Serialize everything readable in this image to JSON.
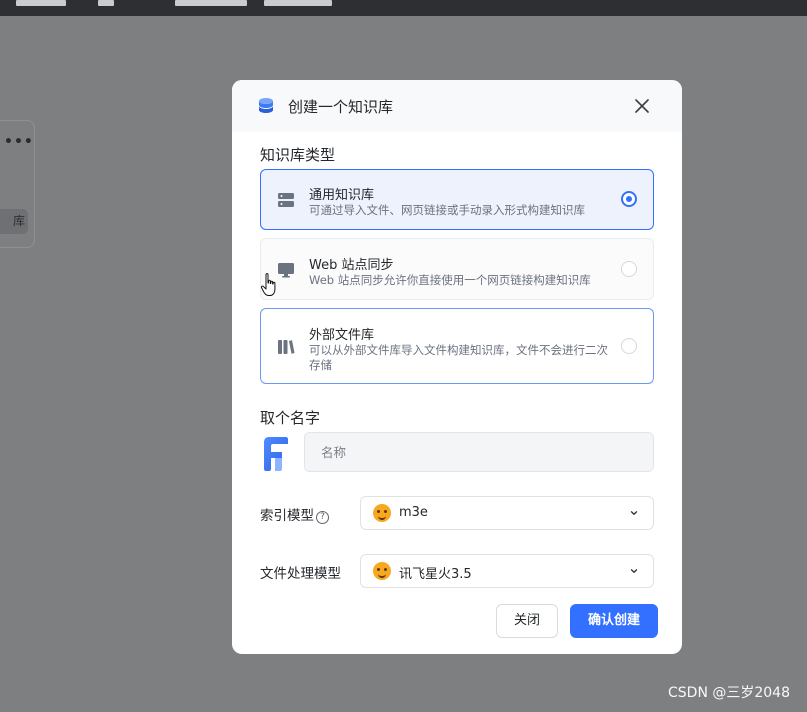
{
  "dialog": {
    "title": "创建一个知识库"
  },
  "kb_type": {
    "label": "知识库类型",
    "options": [
      {
        "title": "通用知识库",
        "desc": "可通过导入文件、网页链接或手动录入形式构建知识库",
        "selected": true
      },
      {
        "title": "Web 站点同步",
        "desc": "Web 站点同步允许你直接使用一个网页链接构建知识库",
        "selected": false
      },
      {
        "title": "外部文件库",
        "desc": "可以从外部文件库导入文件构建知识库，文件不会进行二次存储",
        "selected": false
      }
    ]
  },
  "name": {
    "label": "取个名字",
    "placeholder": "名称",
    "value": ""
  },
  "index_model": {
    "label": "索引模型",
    "value": "m3e"
  },
  "file_model": {
    "label": "文件处理模型",
    "value": "讯飞星火3.5"
  },
  "buttons": {
    "close": "关闭",
    "confirm": "确认创建"
  },
  "background": {
    "tag_text": "库",
    "more": "•••"
  },
  "watermark": "CSDN @三岁2048",
  "colors": {
    "accent": "#3370ff",
    "overlay": "#7e7f81"
  }
}
